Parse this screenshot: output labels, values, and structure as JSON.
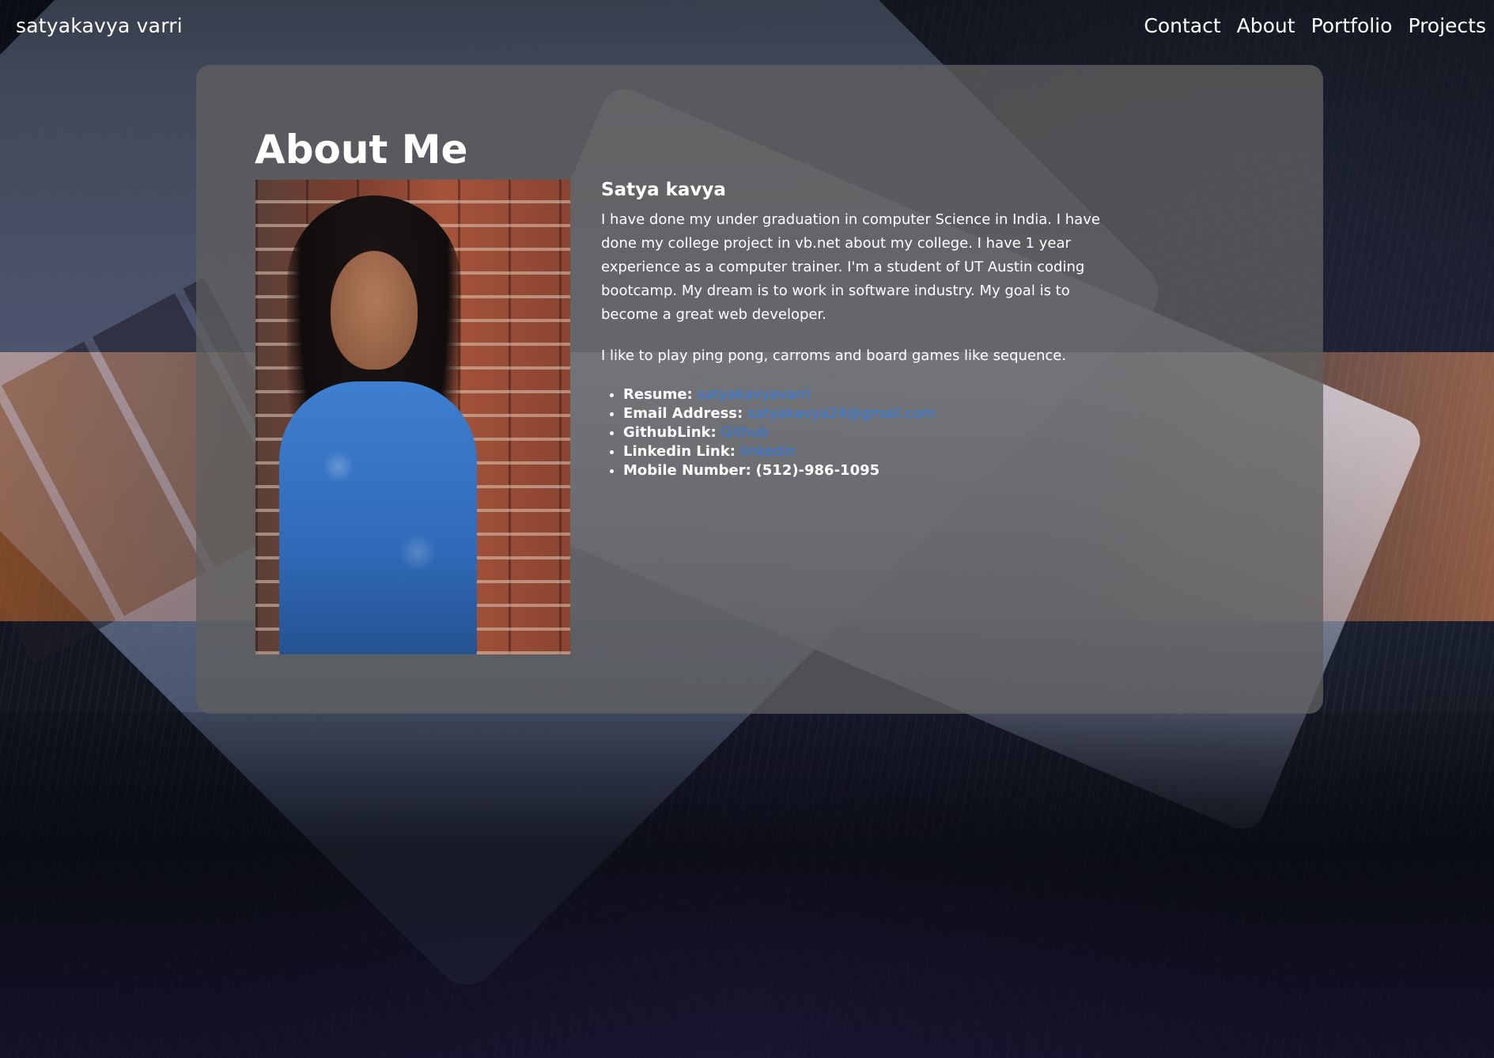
{
  "navbar": {
    "brand": "satyakavya varri",
    "links": [
      "Contact",
      "About",
      "Portfolio",
      "Projects"
    ]
  },
  "about": {
    "heading": "About Me",
    "name": "Satya kavya",
    "bio": "I have done my under graduation in computer Science in India. I have done my college project in vb.net about my college. I have 1 year experience as a computer trainer. I'm a student of UT Austin coding bootcamp. My dream is to work in software industry. My goal is to become a great web developer.",
    "hobbies": "I like to play ping pong, carroms and board games like sequence.",
    "details": [
      {
        "label": "Resume:",
        "link": "satyakavyavarri"
      },
      {
        "label": "Email Address:",
        "link": "satyakavya24@gmail.com"
      },
      {
        "label": "GithubLink:",
        "link": "Github"
      },
      {
        "label": "Linkedin Link:",
        "link": "linkedin"
      },
      {
        "label": "Mobile Number:",
        "value": "(512)-986-1095"
      }
    ]
  },
  "colors": {
    "link": "#2f7ae5",
    "card": "rgba(95,95,95,0.78)",
    "text": "#ffffff"
  }
}
